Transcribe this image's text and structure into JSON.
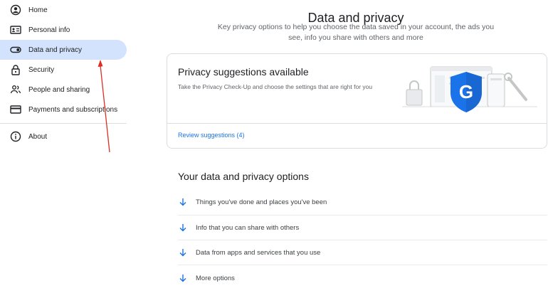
{
  "sidebar": {
    "items": [
      {
        "label": "Home",
        "icon": "home-icon"
      },
      {
        "label": "Personal info",
        "icon": "id-card-icon"
      },
      {
        "label": "Data and privacy",
        "icon": "toggle-icon",
        "active": true
      },
      {
        "label": "Security",
        "icon": "lock-icon"
      },
      {
        "label": "People and sharing",
        "icon": "people-icon"
      },
      {
        "label": "Payments and subscriptions",
        "icon": "credit-card-icon"
      },
      {
        "label": "About",
        "icon": "info-icon"
      }
    ]
  },
  "header": {
    "title": "Data and privacy",
    "subtitle": "Key privacy options to help you choose the data saved in your account, the ads you see, info you share with others and more"
  },
  "suggestion_card": {
    "title": "Privacy suggestions available",
    "description": "Take the Privacy Check-Up and choose the settings that are right for you",
    "link": "Review suggestions (4)",
    "shield_letter": "G"
  },
  "options": {
    "title": "Your data and privacy options",
    "items": [
      {
        "label": "Things you've done and places you've been"
      },
      {
        "label": "Info that you can share with others"
      },
      {
        "label": "Data from apps and services that you use"
      },
      {
        "label": "More options"
      }
    ]
  },
  "colors": {
    "active_bg": "#d3e3fd",
    "link": "#1a73e8",
    "shield": "#1a73e8",
    "annotation_arrow": "#d93025"
  }
}
